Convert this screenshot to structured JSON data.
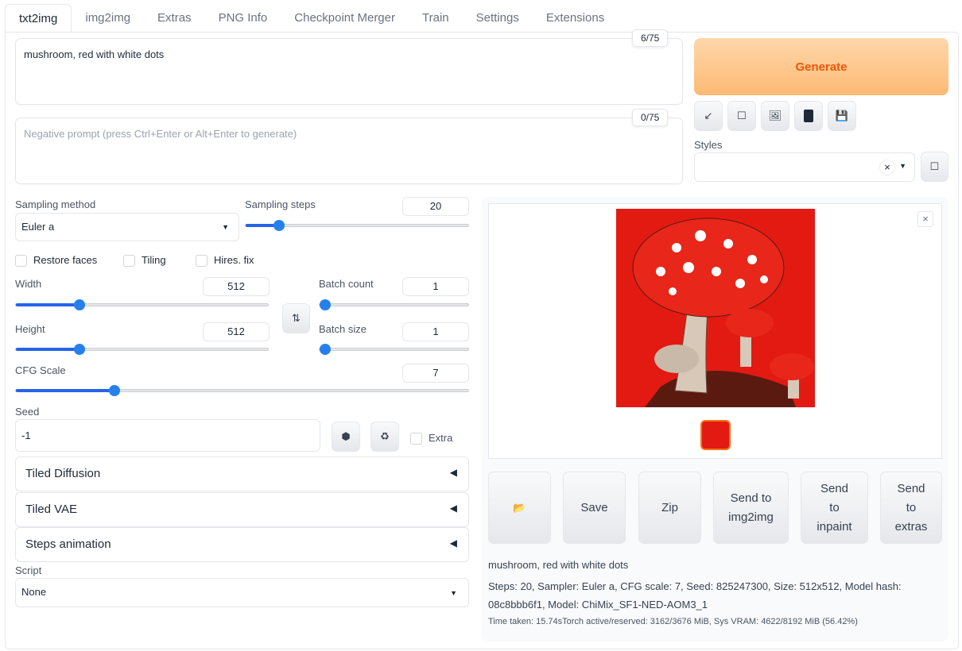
{
  "tabs": [
    "txt2img",
    "img2img",
    "Extras",
    "PNG Info",
    "Checkpoint Merger",
    "Train",
    "Settings",
    "Extensions"
  ],
  "prompt": {
    "value": "mushroom, red with white dots",
    "counter": "6/75"
  },
  "negative": {
    "placeholder": "Negative prompt (press Ctrl+Enter or Alt+Enter to generate)",
    "counter": "0/75"
  },
  "generate_label": "Generate",
  "styles_label": "Styles",
  "sampling": {
    "method_label": "Sampling method",
    "method": "Euler a",
    "steps_label": "Sampling steps",
    "steps": "20",
    "steps_frac": 0.13
  },
  "checkboxes": [
    "Restore faces",
    "Tiling",
    "Hires. fix"
  ],
  "width": {
    "label": "Width",
    "value": "512",
    "frac": 0.24
  },
  "height": {
    "label": "Height",
    "value": "512",
    "frac": 0.24
  },
  "batch_count": {
    "label": "Batch count",
    "value": "1",
    "frac": 0
  },
  "batch_size": {
    "label": "Batch size",
    "value": "1",
    "frac": 0
  },
  "cfg": {
    "label": "CFG Scale",
    "value": "7",
    "frac": 0.21
  },
  "seed": {
    "label": "Seed",
    "value": "-1",
    "extra": "Extra"
  },
  "accordions": [
    "Tiled Diffusion",
    "Tiled VAE",
    "Steps animation"
  ],
  "script": {
    "label": "Script",
    "value": "None"
  },
  "actions": [
    "Save",
    "Zip",
    "Send to img2img",
    "Send to inpaint",
    "Send to extras"
  ],
  "info": {
    "prompt": "mushroom, red with white dots",
    "params": "Steps: 20, Sampler: Euler a, CFG scale: 7, Seed: 825247300, Size: 512x512, Model hash: 08c8bbb6f1, Model: ChiMix_SF1-NED-AOM3_1",
    "time": "Time taken: 15.74sTorch active/reserved: 3162/3676 MiB, Sys VRAM: 4622/8192 MiB (56.42%)"
  },
  "colors": {
    "accent": "#2563eb",
    "generate": "#ea580c"
  }
}
